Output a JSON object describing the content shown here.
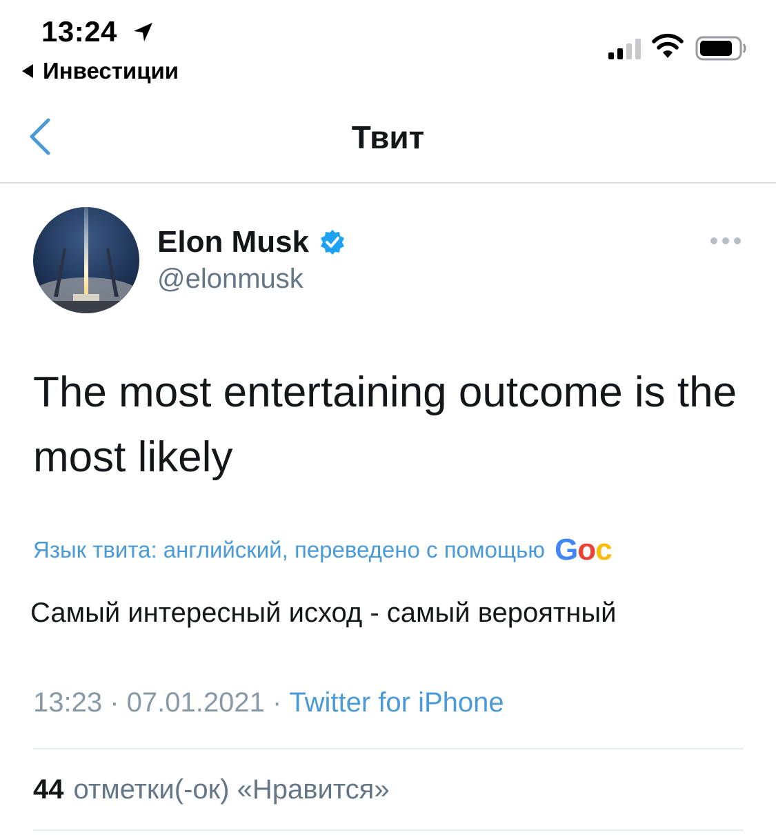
{
  "status_bar": {
    "time": "13:24",
    "back_app": "Инвестиции"
  },
  "nav": {
    "title": "Твит"
  },
  "author": {
    "name": "Elon Musk",
    "handle": "@elonmusk"
  },
  "tweet": {
    "text": "The most entertaining outcome is the most likely",
    "translation_note": "Язык твита: английский, переведено с помощью",
    "google_logo_text": "Goc",
    "translation": "Самый интересный исход - самый вероятный"
  },
  "meta": {
    "time": "13:23",
    "separator1": " · ",
    "date": "07.01.2021",
    "separator2": " · ",
    "source": "Twitter for iPhone"
  },
  "likes": {
    "count": "44",
    "label": "отметки(-ок) «Нравится»"
  },
  "colors": {
    "accent": "#4a9ad6",
    "text": "#14171a",
    "secondary": "#657786",
    "verified": "#1da1f2"
  }
}
